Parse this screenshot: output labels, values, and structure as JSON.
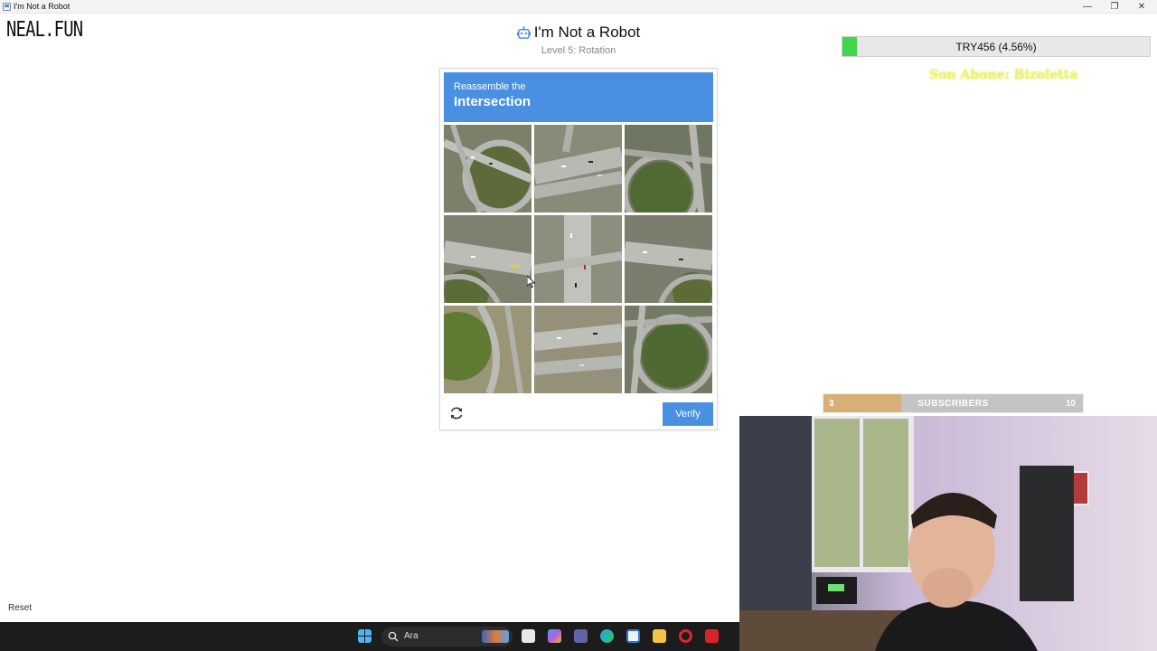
{
  "window": {
    "title": "I'm Not a Robot",
    "minimize": "—",
    "maximize": "❐",
    "close": "✕"
  },
  "site": {
    "logo": "NEAL.FUN"
  },
  "game": {
    "title": "I'm Not a Robot",
    "level": "Level 5: Rotation"
  },
  "captcha": {
    "instruction_small": "Reassemble the",
    "instruction_big": "Intersection",
    "verify_label": "Verify",
    "tiles": [
      "tile-1",
      "tile-2",
      "tile-3",
      "tile-4",
      "tile-5",
      "tile-6",
      "tile-7",
      "tile-8",
      "tile-9"
    ]
  },
  "stream_overlay": {
    "goal_label": "TRY456 (4.56%)",
    "goal_progress": 0.0456,
    "last_subscriber": "Son Abone: Bizoletta",
    "subscribers": {
      "current": "3",
      "label": "SUBSCRIBERS",
      "goal": "10",
      "progress": 0.3
    }
  },
  "page": {
    "reset_label": "Reset"
  },
  "taskbar": {
    "search_placeholder": "Ara"
  },
  "colors": {
    "accent": "#4a90e2",
    "goal_fill": "#41d54c",
    "sub_fill": "#d6b076"
  }
}
